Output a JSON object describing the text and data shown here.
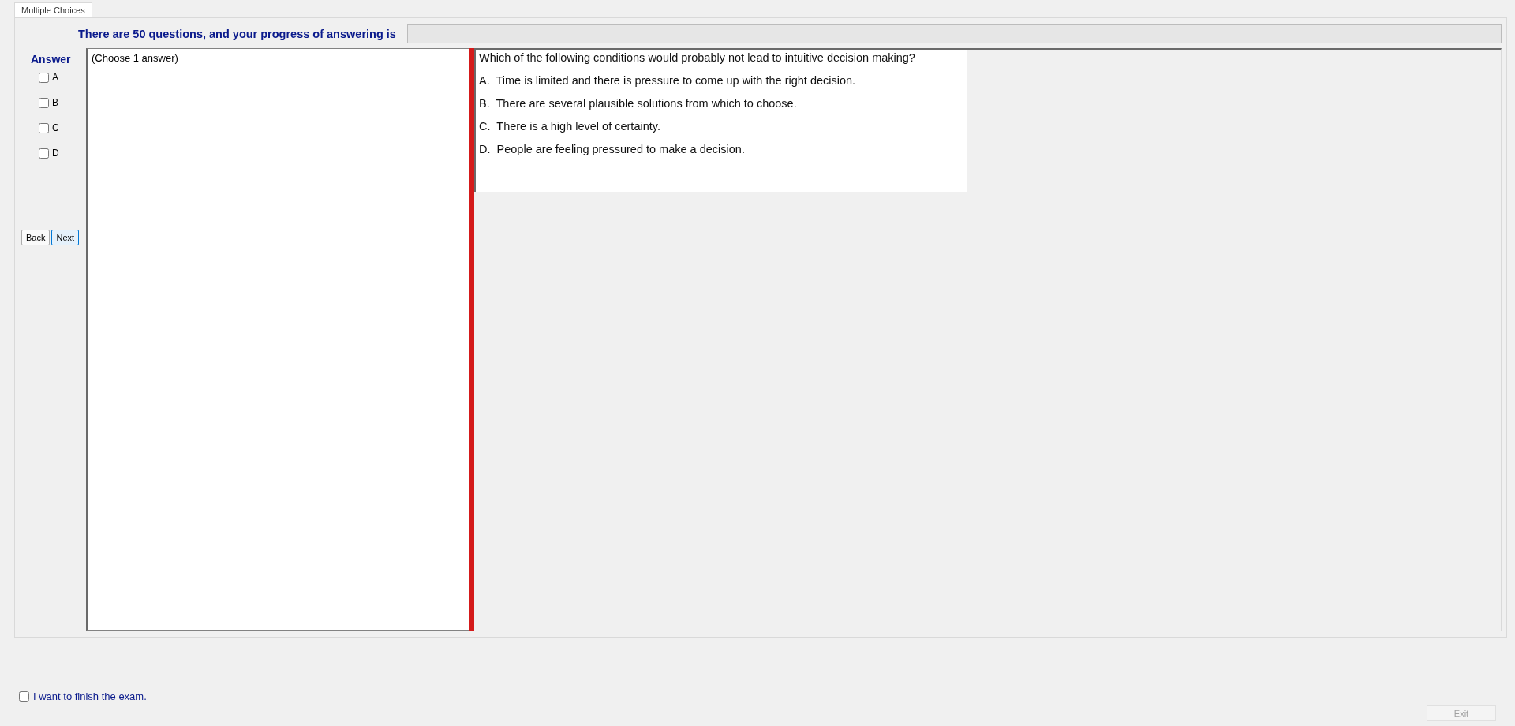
{
  "tabs": [
    {
      "label": "Multiple Choices",
      "selected": true
    }
  ],
  "progress": {
    "label": "There are 50 questions, and your progress of answering is",
    "level": 0
  },
  "answer": {
    "title": "Answer",
    "options": [
      {
        "label": "A",
        "checked": false
      },
      {
        "label": "B",
        "checked": false
      },
      {
        "label": "C",
        "checked": false
      },
      {
        "label": "D",
        "checked": false
      }
    ]
  },
  "nav_buttons": [
    {
      "label": "Back",
      "focused": false
    },
    {
      "label": "Next",
      "focused": true
    }
  ],
  "instruction": "(Choose 1 answer)",
  "question": {
    "text": "Which of the following conditions would probably not lead to intuitive decision making?",
    "choices": [
      "A.  Time is limited and there is pressure to come up with the right decision.",
      "B.  There are several plausible solutions from which to choose.",
      "C.  There is a high level of certainty.",
      "D.  People are feeling pressured to make a decision."
    ]
  },
  "finish": {
    "label": "I want to finish the exam.",
    "checked": false
  },
  "exit_button": {
    "label": "Exit",
    "disabled": true
  }
}
